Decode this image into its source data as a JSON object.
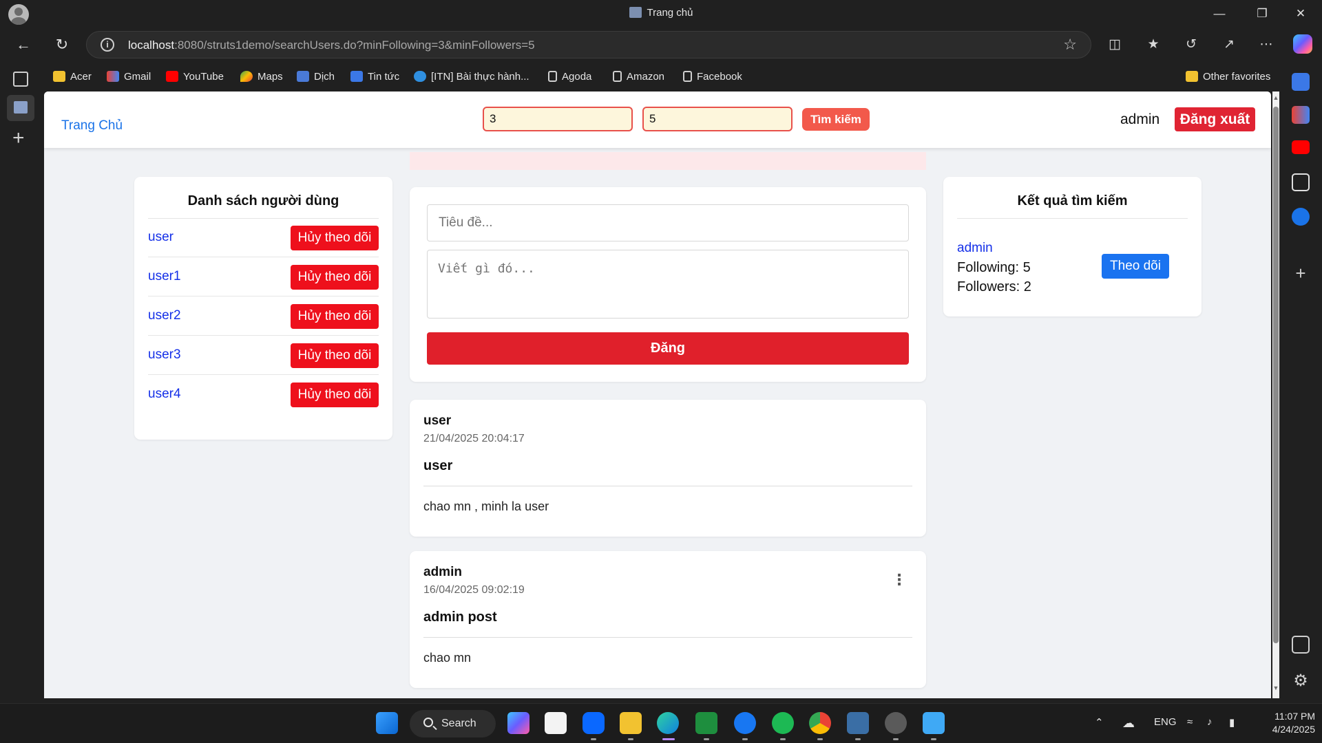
{
  "browser": {
    "tab_title": "Trang chủ",
    "url_host": "localhost",
    "url_rest": ":8080/struts1demo/searchUsers.do?minFollowing=3&minFollowers=5",
    "bookmarks": [
      "Acer",
      "Gmail",
      "YouTube",
      "Maps",
      "Dịch",
      "Tin tức",
      "[ITN] Bài thực hành...",
      "Agoda",
      "Amazon",
      "Facebook"
    ],
    "other_favorites": "Other favorites"
  },
  "header": {
    "home_link": "Trang Chủ",
    "min_following_value": "3",
    "min_followers_value": "5",
    "search_button": "Tìm kiếm",
    "username": "admin",
    "logout_button": "Đăng xuất"
  },
  "users_panel": {
    "title": "Danh sách người dùng",
    "users": [
      {
        "name": "user",
        "action": "Hủy theo dõi"
      },
      {
        "name": "user1",
        "action": "Hủy theo dõi"
      },
      {
        "name": "user2",
        "action": "Hủy theo dõi"
      },
      {
        "name": "user3",
        "action": "Hủy theo dõi"
      },
      {
        "name": "user4",
        "action": "Hủy theo dõi"
      }
    ]
  },
  "composer": {
    "title_placeholder": "Tiêu đề...",
    "body_placeholder": "Viết gì đó...",
    "submit_label": "Đăng"
  },
  "posts": [
    {
      "author": "user",
      "time": "21/04/2025 20:04:17",
      "title": "user",
      "body": "chao mn , minh la user"
    },
    {
      "author": "admin",
      "time": "16/04/2025 09:02:19",
      "title": "admin post",
      "body": "chao mn"
    }
  ],
  "results_panel": {
    "title": "Kết quả tìm kiếm",
    "result": {
      "name": "admin",
      "following": "Following: 5",
      "followers": "Followers: 2",
      "action": "Theo dõi"
    }
  },
  "taskbar": {
    "search_label": "Search",
    "language": "ENG",
    "time": "11:07 PM",
    "date": "4/24/2025"
  },
  "colors": {
    "accent_red": "#e0202b",
    "link_blue": "#1530e8",
    "follow_blue": "#1a73f0",
    "search_orange": "#f2594b"
  }
}
